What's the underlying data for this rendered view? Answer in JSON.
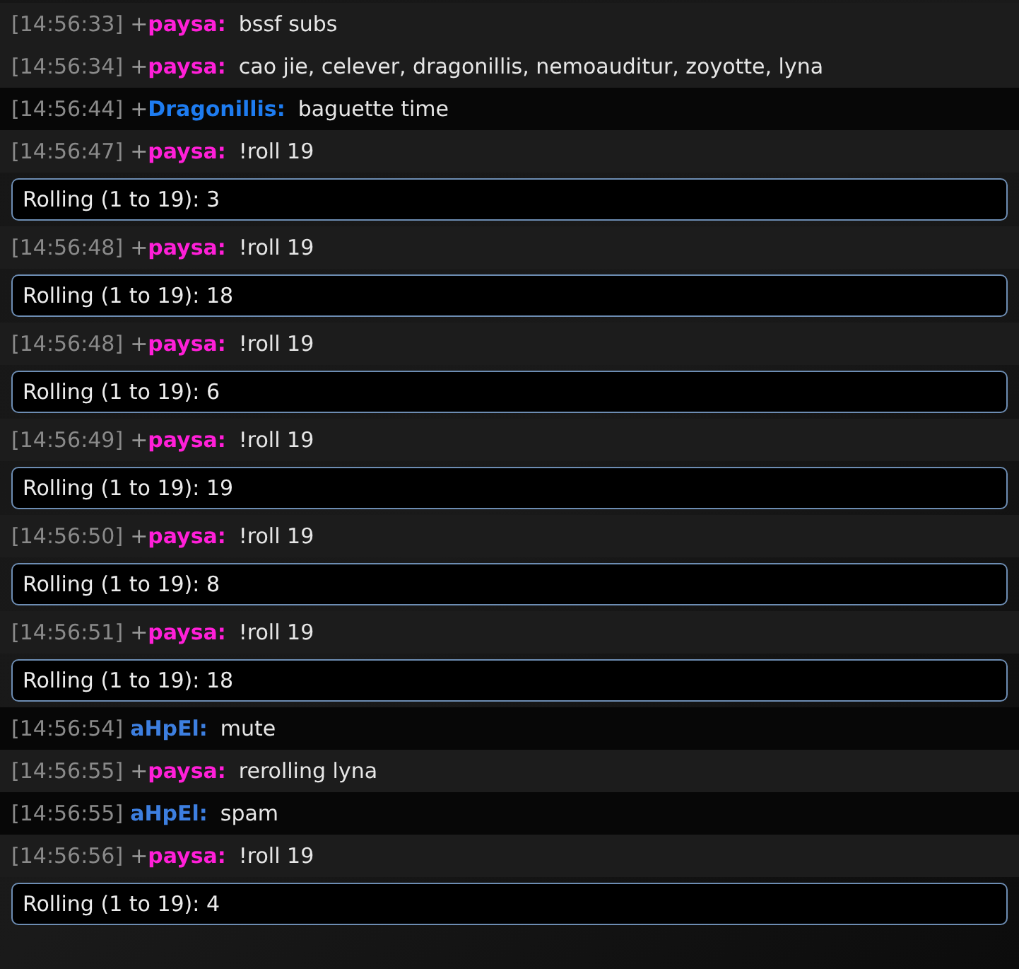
{
  "log": [
    {
      "kind": "message",
      "timestamp": "[14:56:33]",
      "prefix": "+",
      "user": "paysa:",
      "color": "#ff1fd8",
      "text": "bssf subs",
      "dark": false
    },
    {
      "kind": "message",
      "timestamp": "[14:56:34]",
      "prefix": "+",
      "user": "paysa:",
      "color": "#ff1fd8",
      "text": "cao jie, celever, dragonillis, nemoauditur, zoyotte, lyna",
      "dark": false
    },
    {
      "kind": "message",
      "timestamp": "[14:56:44]",
      "prefix": "+",
      "user": "Dragonillis:",
      "color": "#1e7cf0",
      "text": "baguette time",
      "dark": true
    },
    {
      "kind": "message",
      "timestamp": "[14:56:47]",
      "prefix": "+",
      "user": "paysa:",
      "color": "#ff1fd8",
      "text": "!roll 19",
      "dark": false
    },
    {
      "kind": "roll",
      "text": "Rolling (1 to 19): 3"
    },
    {
      "kind": "message",
      "timestamp": "[14:56:48]",
      "prefix": "+",
      "user": "paysa:",
      "color": "#ff1fd8",
      "text": "!roll 19",
      "dark": false
    },
    {
      "kind": "roll",
      "text": "Rolling (1 to 19): 18"
    },
    {
      "kind": "message",
      "timestamp": "[14:56:48]",
      "prefix": "+",
      "user": "paysa:",
      "color": "#ff1fd8",
      "text": "!roll 19",
      "dark": false
    },
    {
      "kind": "roll",
      "text": "Rolling (1 to 19): 6"
    },
    {
      "kind": "message",
      "timestamp": "[14:56:49]",
      "prefix": "+",
      "user": "paysa:",
      "color": "#ff1fd8",
      "text": "!roll 19",
      "dark": false
    },
    {
      "kind": "roll",
      "text": "Rolling (1 to 19): 19"
    },
    {
      "kind": "message",
      "timestamp": "[14:56:50]",
      "prefix": "+",
      "user": "paysa:",
      "color": "#ff1fd8",
      "text": "!roll 19",
      "dark": false
    },
    {
      "kind": "roll",
      "text": "Rolling (1 to 19): 8"
    },
    {
      "kind": "message",
      "timestamp": "[14:56:51]",
      "prefix": "+",
      "user": "paysa:",
      "color": "#ff1fd8",
      "text": "!roll 19",
      "dark": false
    },
    {
      "kind": "roll",
      "text": "Rolling (1 to 19): 18"
    },
    {
      "kind": "message",
      "timestamp": "[14:56:54]",
      "user": "aHpEl:",
      "color": "#3d7fe0",
      "text": "mute",
      "dark": true
    },
    {
      "kind": "message",
      "timestamp": "[14:56:55]",
      "prefix": "+",
      "user": "paysa:",
      "color": "#ff1fd8",
      "text": "rerolling lyna",
      "dark": false
    },
    {
      "kind": "message",
      "timestamp": "[14:56:55]",
      "user": "aHpEl:",
      "color": "#3d7fe0",
      "text": "spam",
      "dark": true
    },
    {
      "kind": "message",
      "timestamp": "[14:56:56]",
      "prefix": "+",
      "user": "paysa:",
      "color": "#ff1fd8",
      "text": "!roll 19",
      "dark": false
    },
    {
      "kind": "roll",
      "text": "Rolling (1 to 19): 4"
    }
  ]
}
